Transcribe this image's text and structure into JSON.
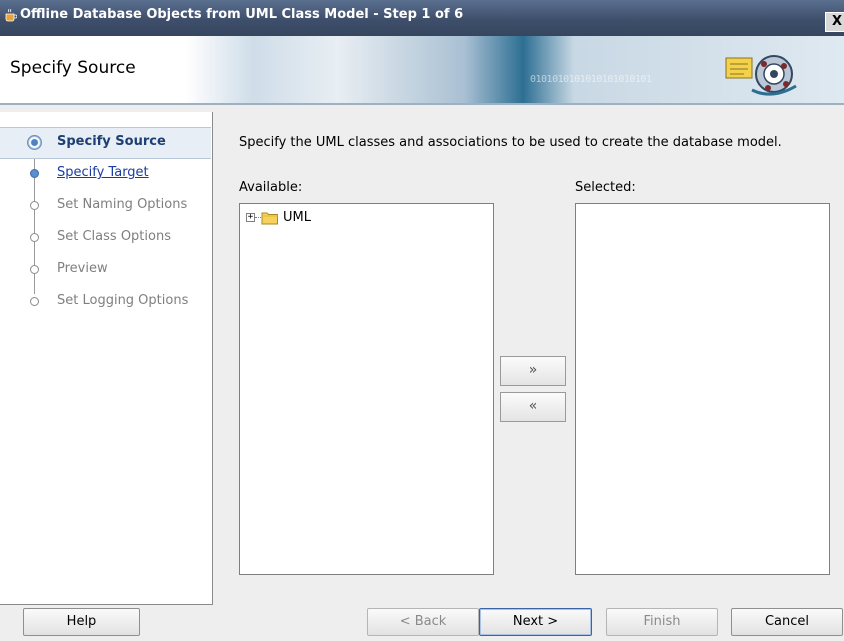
{
  "window": {
    "title": "Offline Database Objects from UML Class Model - Step 1 of 6",
    "close_glyph": "X"
  },
  "header": {
    "title": "Specify Source",
    "binary_text": "0101010101010101010101"
  },
  "steps": [
    {
      "label": "Specify Source",
      "state": "current"
    },
    {
      "label": "Specify Target",
      "state": "next"
    },
    {
      "label": "Set Naming Options",
      "state": "disabled"
    },
    {
      "label": "Set Class Options",
      "state": "disabled"
    },
    {
      "label": "Preview",
      "state": "disabled"
    },
    {
      "label": "Set Logging Options",
      "state": "disabled"
    }
  ],
  "content": {
    "instruction": "Specify the UML classes and associations to be used to create the database model.",
    "available_label": "Available:",
    "selected_label": "Selected:",
    "available_items": [
      {
        "label": "UML",
        "expander": "+",
        "icon": "folder-icon"
      }
    ],
    "selected_items": [],
    "add_glyph": "»",
    "remove_glyph": "«"
  },
  "buttons": {
    "help": "Help",
    "back": "< Back",
    "next": "Next >",
    "finish": "Finish",
    "cancel": "Cancel"
  },
  "colors": {
    "title_bar": "#3e4f6b",
    "current_step_text": "#1d3f73",
    "link_step_text": "#1a3c9e",
    "disabled_text": "#7f7f7f"
  }
}
